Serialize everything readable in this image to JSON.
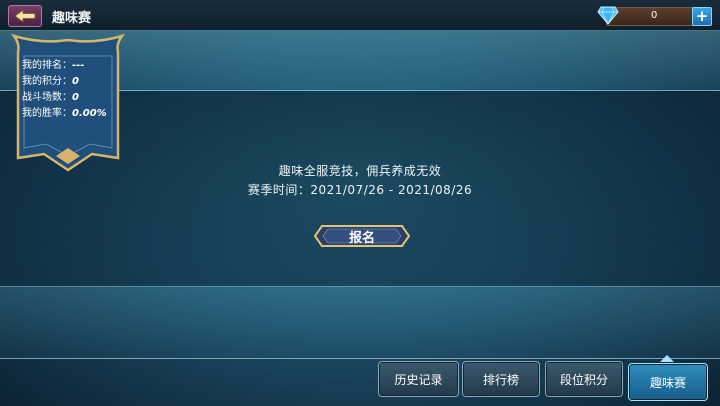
{
  "header": {
    "title": "趣味赛",
    "currency_value": "0",
    "plus_label": "+"
  },
  "stats": {
    "rank_label": "我的排名：",
    "rank_value": "---",
    "points_label": "我的积分：",
    "points_value": "0",
    "battles_label": "战斗场数：",
    "battles_value": "0",
    "winrate_label": "我的胜率：",
    "winrate_value": "0.00%"
  },
  "event": {
    "description": "趣味全服竞技，佣兵养成无效",
    "season": "赛季时间：2021/07/26 - 2021/08/26",
    "signup_label": "报名"
  },
  "tabs": [
    {
      "label": "历史记录",
      "active": false
    },
    {
      "label": "排行榜",
      "active": false
    },
    {
      "label": "段位积分",
      "active": false
    },
    {
      "label": "趣味赛",
      "active": true
    }
  ],
  "icons": [
    "back-arrow-icon",
    "diamond-icon",
    "plus-icon"
  ],
  "colors": {
    "accent": "#2f8fc0",
    "banner_gold": "#d8b46a",
    "banner_blue": "#1f4f7a"
  }
}
